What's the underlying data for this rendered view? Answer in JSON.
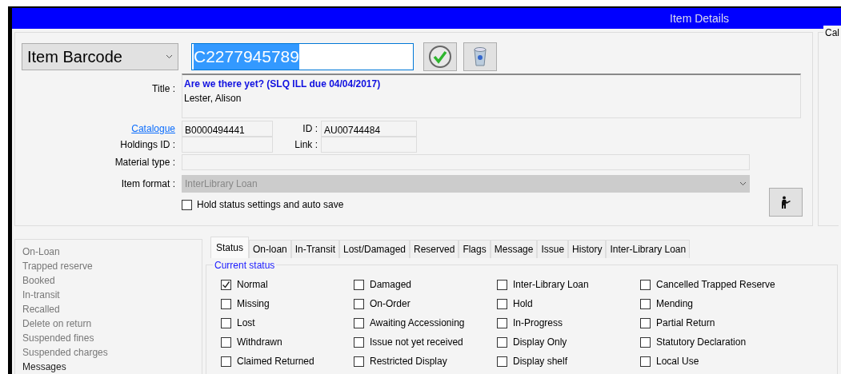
{
  "window": {
    "title": "Item Details"
  },
  "lookup": {
    "type": "Item Barcode",
    "value": "C2277945789"
  },
  "title_field": {
    "label": "Title :",
    "title": "Are we there yet? (SLQ ILL due 04/04/2017)",
    "author": "Lester, Alison"
  },
  "catalogue": {
    "link": "Catalogue",
    "value": "B0000494441"
  },
  "id": {
    "label": "ID :",
    "value": "AU00744484"
  },
  "holdings_id": {
    "label": "Holdings ID :"
  },
  "link": {
    "label": "Link :"
  },
  "material_type": {
    "label": "Material type :"
  },
  "item_format": {
    "label": "Item format :",
    "value": "InterLibrary Loan",
    "disabled": true
  },
  "hold_status": {
    "label": "Hold status settings and auto save",
    "checked": false
  },
  "side_panel": {
    "legend": "Cal"
  },
  "flags": [
    {
      "label": "On-Loan",
      "disabled": true
    },
    {
      "label": "Trapped reserve",
      "disabled": true
    },
    {
      "label": "Booked",
      "disabled": true
    },
    {
      "label": "In-transit",
      "disabled": true
    },
    {
      "label": "Recalled",
      "disabled": true
    },
    {
      "label": "Delete on return",
      "disabled": true
    },
    {
      "label": "Suspended fines",
      "disabled": true
    },
    {
      "label": "Suspended charges",
      "disabled": true
    },
    {
      "label": "Messages",
      "disabled": false
    }
  ],
  "tabs": [
    {
      "label": "Status",
      "selected": true
    },
    {
      "label": "On-loan",
      "selected": false
    },
    {
      "label": "In-Transit",
      "selected": false
    },
    {
      "label": "Lost/Damaged",
      "selected": false
    },
    {
      "label": "Reserved",
      "selected": false
    },
    {
      "label": "Flags",
      "selected": false
    },
    {
      "label": "Message",
      "selected": false
    },
    {
      "label": "Issue",
      "selected": false
    },
    {
      "label": "History",
      "selected": false
    },
    {
      "label": "Inter-Library Loan",
      "selected": false
    }
  ],
  "current_status": {
    "legend": "Current status",
    "columns": [
      [
        {
          "label": "Normal",
          "checked": true
        },
        {
          "label": "Missing",
          "checked": false
        },
        {
          "label": "Lost",
          "checked": false
        },
        {
          "label": "Withdrawn",
          "checked": false
        },
        {
          "label": "Claimed Returned",
          "checked": false
        }
      ],
      [
        {
          "label": "Damaged",
          "checked": false
        },
        {
          "label": "On-Order",
          "checked": false
        },
        {
          "label": "Awaiting Accessioning",
          "checked": false
        },
        {
          "label": "Issue not yet received",
          "checked": false
        },
        {
          "label": "Restricted Display",
          "checked": false
        }
      ],
      [
        {
          "label": "Inter-Library Loan",
          "checked": false
        },
        {
          "label": "Hold",
          "checked": false
        },
        {
          "label": "In-Progress",
          "checked": false
        },
        {
          "label": "Display Only",
          "checked": false
        },
        {
          "label": "Display shelf",
          "checked": false
        }
      ],
      [
        {
          "label": "Cancelled Trapped Reserve",
          "checked": false
        },
        {
          "label": "Mending",
          "checked": false
        },
        {
          "label": "Partial Return",
          "checked": false
        },
        {
          "label": "Statutory Declaration",
          "checked": false
        },
        {
          "label": "Local Use",
          "checked": false
        }
      ]
    ]
  }
}
